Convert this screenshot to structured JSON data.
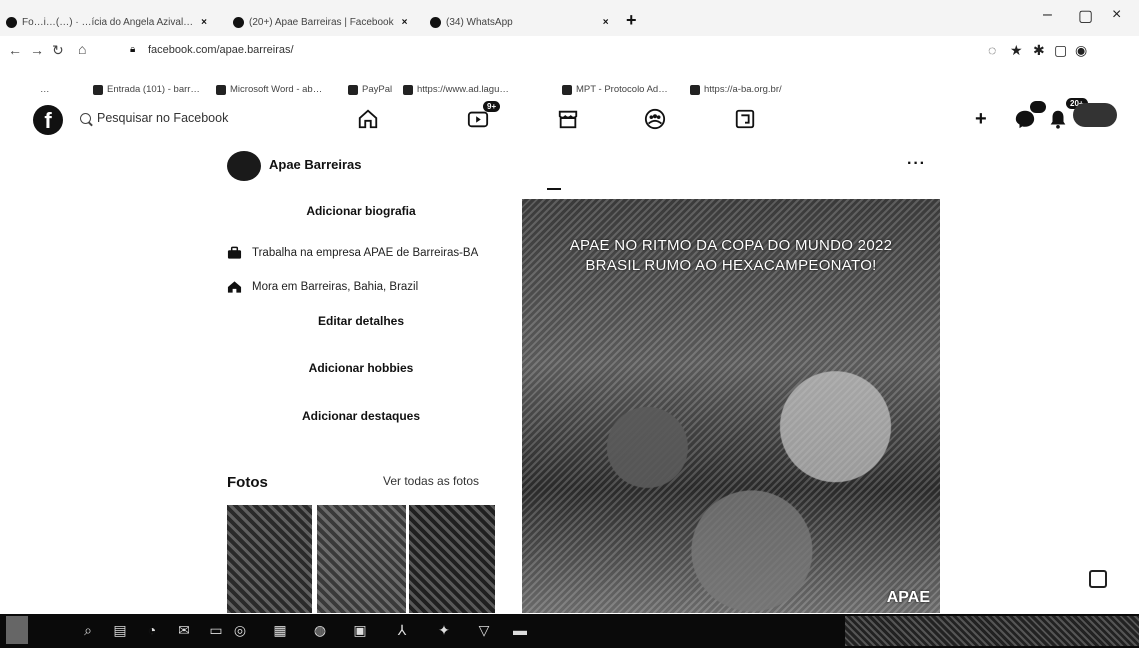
{
  "browser": {
    "tabs": [
      {
        "label": "Fo…i…(…) · …ícia do Angela Azival…"
      },
      {
        "label": "(20+) Apae Barreiras | Facebook"
      },
      {
        "label": "(34) WhatsApp"
      }
    ],
    "new_tab": "+",
    "window_controls": [
      "–",
      "▢",
      "×"
    ],
    "url": "facebook.com/apae.barreiras/",
    "bookmarks": [
      "…",
      "Entrada (101) - barr…",
      "Microsoft Word - ab…",
      "PayPal",
      "https://www.ad.lagu…",
      "MPT - Protocolo Ad…",
      "https://a-ba.org.br/"
    ]
  },
  "facebook": {
    "search_placeholder": "Pesquisar no Facebook",
    "watch_badge": "9+",
    "messenger_badge": "",
    "notifications_badge": "20+",
    "plus": "+"
  },
  "profile": {
    "name": "Apae Barreiras",
    "more": "···",
    "add_bio": "Adicionar biografia",
    "work": "Trabalha na empresa APAE de Barreiras-BA",
    "lives": "Mora em Barreiras, Bahia, Brazil",
    "edit_details": "Editar detalhes",
    "add_hobbies": "Adicionar hobbies",
    "add_featured": "Adicionar destaques",
    "photos_title": "Fotos",
    "photos_link": "Ver todas as fotos"
  },
  "post": {
    "caption_line1": "APAE NO RITMO DA COPA DO MUNDO 2022",
    "caption_line2": "BRASIL RUMO AO HEXACAMPEONATO!",
    "brand": "APAE"
  }
}
